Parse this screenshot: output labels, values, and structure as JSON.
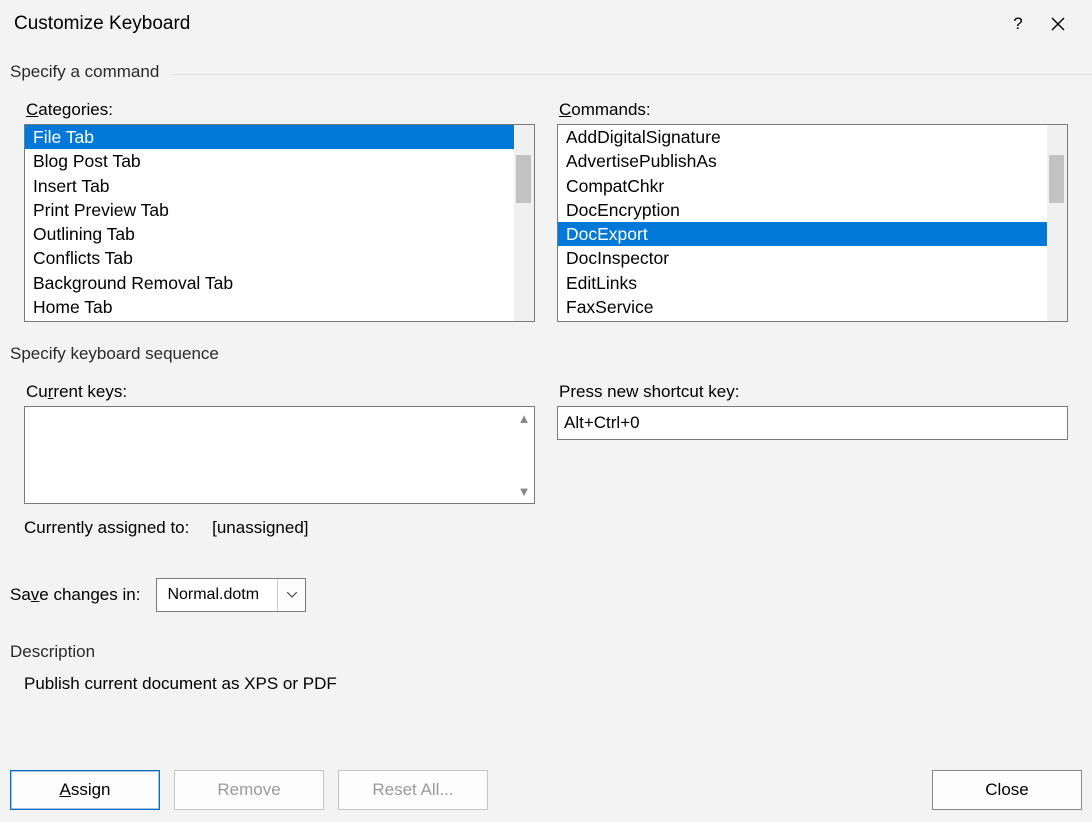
{
  "dialog": {
    "title": "Customize Keyboard"
  },
  "section": {
    "specify_command": "Specify a command",
    "specify_sequence": "Specify keyboard sequence",
    "description": "Description"
  },
  "labels": {
    "categories": "ategories:",
    "categories_pre": "C",
    "commands": "ommands:",
    "commands_pre": "C",
    "current_keys": "rrent keys:",
    "current_keys_pre": "Cu",
    "press_new": "ew shortcut key:",
    "press_new_pre": "Press n",
    "assigned_to": "Currently assigned to:",
    "assigned_val": "[unassigned]",
    "save_in": "e changes in:",
    "save_in_pre": "Sav"
  },
  "categories": [
    "File Tab",
    "Blog Post Tab",
    "Insert Tab",
    "Print Preview Tab",
    "Outlining Tab",
    "Conflicts Tab",
    "Background Removal Tab",
    "Home Tab"
  ],
  "categories_selected_index": 0,
  "commands": [
    "AddDigitalSignature",
    "AdvertisePublishAs",
    "CompatChkr",
    "DocEncryption",
    "DocExport",
    "DocInspector",
    "EditLinks",
    "FaxService"
  ],
  "commands_selected_index": 4,
  "shortcut": {
    "value": "Alt+Ctrl+0"
  },
  "save_changes": {
    "selected": "Normal.dotm"
  },
  "description_text": "Publish current document as XPS or PDF",
  "buttons": {
    "assign_pre": "A",
    "assign": "ssign",
    "remove": "Remove",
    "reset": "Reset All...",
    "close": "Close"
  }
}
